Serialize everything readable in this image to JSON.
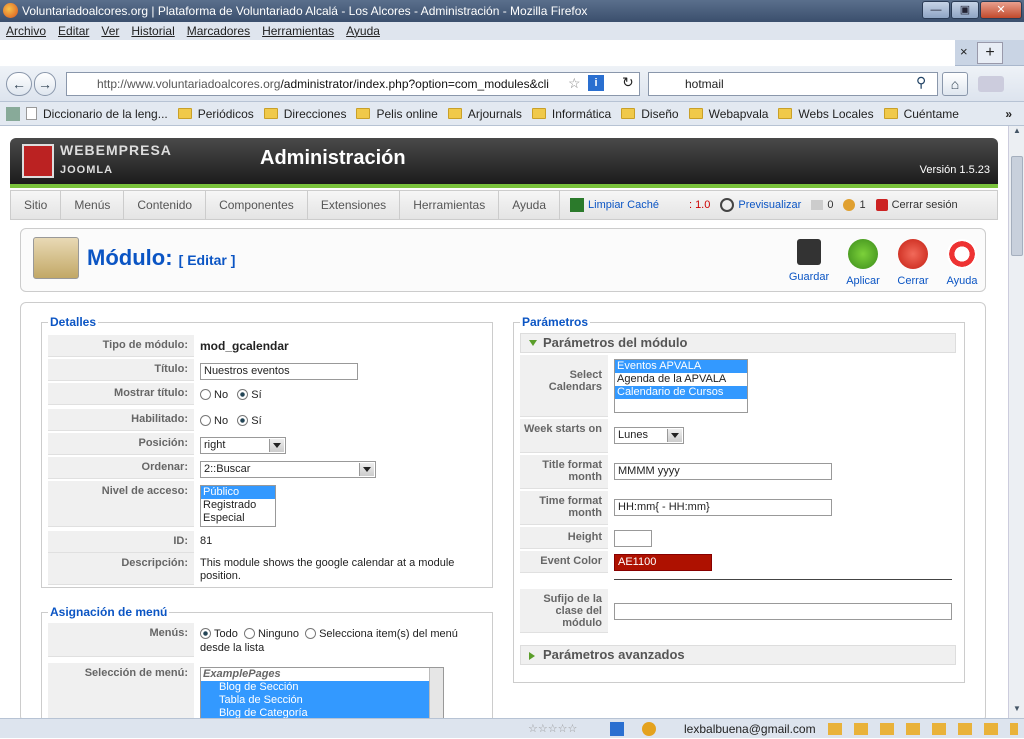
{
  "window": {
    "title": "Voluntariadoalcores.org | Plataforma de Voluntariado Alcalá - Los Alcores - Administración - Mozilla Firefox",
    "min": "—",
    "max": "▣",
    "close": "✕"
  },
  "menubar": [
    "Archivo",
    "Editar",
    "Ver",
    "Historial",
    "Marcadores",
    "Herramientas",
    "Ayuda"
  ],
  "tabs": {
    "close": "×",
    "new": "+"
  },
  "nav": {
    "url_host": "http://www.voluntariadoalcores.org",
    "url_path": "/administrator/index.php?option=com_modules&cli",
    "search_value": "hotmail",
    "back": "←",
    "forward": "→",
    "reload": "↻",
    "info": "i",
    "star": "☆",
    "search_btn": "⚲",
    "home": "⌂"
  },
  "bookmarks": [
    "Diccionario de la leng...",
    "Periódicos",
    "Direcciones",
    "Pelis online",
    "Arjournals",
    "Informática",
    "Diseño",
    "Webapvala",
    "Webs Locales",
    "Cuéntame"
  ],
  "bookmarks_more": "»",
  "joomla": {
    "brand": "WEBEMPRESA",
    "brand_sub": "JOOMLA",
    "title": "Administración",
    "version": "Versión 1.5.23",
    "menu": [
      "Sitio",
      "Menús",
      "Contenido",
      "Componentes",
      "Extensiones",
      "Herramientas",
      "Ayuda"
    ],
    "status": {
      "clear_cache": "Limpiar Caché",
      "cache_size": ": 1.0",
      "preview": "Previsualizar",
      "messages": "0",
      "users": "1",
      "logout": "Cerrar sesión"
    }
  },
  "toolbar": {
    "title": "Módulo:",
    "subtitle": "[ Editar ]",
    "buttons": [
      "Guardar",
      "Aplicar",
      "Cerrar",
      "Ayuda"
    ]
  },
  "details": {
    "legend": "Detalles",
    "type_label": "Tipo de módulo:",
    "type_value": "mod_gcalendar",
    "title_label": "Título:",
    "title_value": "Nuestros eventos",
    "show_title_label": "Mostrar título:",
    "enabled_label": "Habilitado:",
    "no": "No",
    "yes": "Sí",
    "position_label": "Posición:",
    "position_value": "right",
    "order_label": "Ordenar:",
    "order_value": "2::Buscar",
    "access_label": "Nivel de acceso:",
    "access_options": [
      "Público",
      "Registrado",
      "Especial"
    ],
    "id_label": "ID:",
    "id_value": "81",
    "desc_label": "Descripción:",
    "desc_value": "This module shows the google calendar at a module position."
  },
  "menu_assign": {
    "legend": "Asignación de menú",
    "menus_label": "Menús:",
    "opt_all": "Todo",
    "opt_none": "Ninguno",
    "opt_select": "Selecciona item(s) del menú desde la lista",
    "selection_label": "Selección de menú:",
    "items": [
      "ExamplePages",
      "Blog de Sección",
      "Tabla de Sección",
      "Blog de Categoría"
    ]
  },
  "params": {
    "legend": "Parámetros",
    "panel_title": "Parámetros del módulo",
    "calendars_label": "Select Calendars",
    "calendars": [
      "Eventos APVALA",
      "Agenda de la APVALA",
      "Calendario de Cursos"
    ],
    "week_label": "Week starts on",
    "week_value": "Lunes",
    "title_format_label": "Title format month",
    "title_format_value": "MMMM yyyy",
    "time_format_label": "Time format month",
    "time_format_value": "HH:mm{ - HH:mm}",
    "height_label": "Height",
    "height_value": "",
    "event_color_label": "Event Color",
    "event_color_value": "AE1100",
    "suffix_label": "Sufijo de la clase del módulo",
    "suffix_value": "",
    "advanced_title": "Parámetros avanzados"
  },
  "statusbar": {
    "email": "lexbalbuena@gmail.com"
  },
  "colors": {
    "joomla_blue": "#0b55c4",
    "event_color": "#AE1100",
    "green_bar": "#7ac33c"
  }
}
